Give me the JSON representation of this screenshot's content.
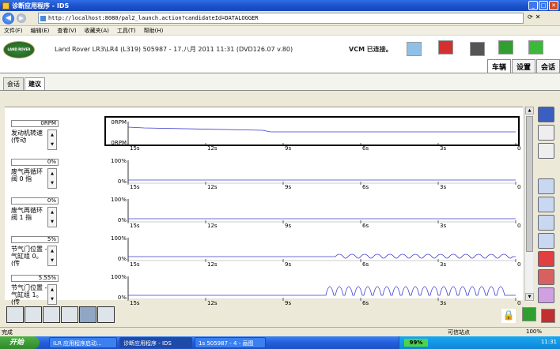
{
  "window": {
    "title": "诊断应用程序 - IDS",
    "url": "http://localhost:8080/pal2_launch.action?candidateId=DATALOGGER"
  },
  "menu": [
    "文件(F)",
    "编辑(E)",
    "查看(V)",
    "收藏夹(A)",
    "工具(T)",
    "帮助(H)"
  ],
  "header": {
    "logo_text": "LAND ROVER",
    "vehicle": "Land Rover LR3\\LR4 (L319) 505987 - 17.八月 2011 11:31 (DVD126.07 v.80)",
    "vcm_status": "VCM 已连接。",
    "tabs": [
      "车辆",
      "设置",
      "会话"
    ]
  },
  "subtabs": [
    "会话",
    "建议"
  ],
  "time_labels": [
    "15s",
    "12s",
    "9s",
    "6s",
    "3s",
    "0s"
  ],
  "rows": [
    {
      "value": "0RPM",
      "label": "发动机转速 (传动",
      "ymax": "0RPM",
      "ymin": "0RPM",
      "selected": true
    },
    {
      "value": "0%",
      "label": "废气再循环阀 0 指",
      "ymax": "100%",
      "ymin": "0%",
      "selected": false
    },
    {
      "value": "0%",
      "label": "废气再循环阀 1 指",
      "ymax": "100%",
      "ymin": "0%",
      "selected": false
    },
    {
      "value": "5%",
      "label": "节气门位置 - 气缸组 0。 (传",
      "ymax": "100%",
      "ymin": "0%",
      "selected": false
    },
    {
      "value": "5.55%",
      "label": "节气门位置 - 气缸组 1。 (传",
      "ymax": "100%",
      "ymin": "0%",
      "selected": false
    }
  ],
  "statusbar": {
    "left": "完成",
    "zone": "可信站点",
    "zoom": "100%"
  },
  "taskbar": {
    "start": "开始",
    "tasks": [
      "ILR 应用程序启动...",
      "诊断应用程序 - IDS",
      "1s 505987 - 4 - 画图"
    ],
    "battery": "99%",
    "clock": "11:31"
  },
  "colors": {
    "plot_line": "#3b3bd0",
    "title_bar": "#245edb",
    "logo_green": "#1c5a1c"
  }
}
